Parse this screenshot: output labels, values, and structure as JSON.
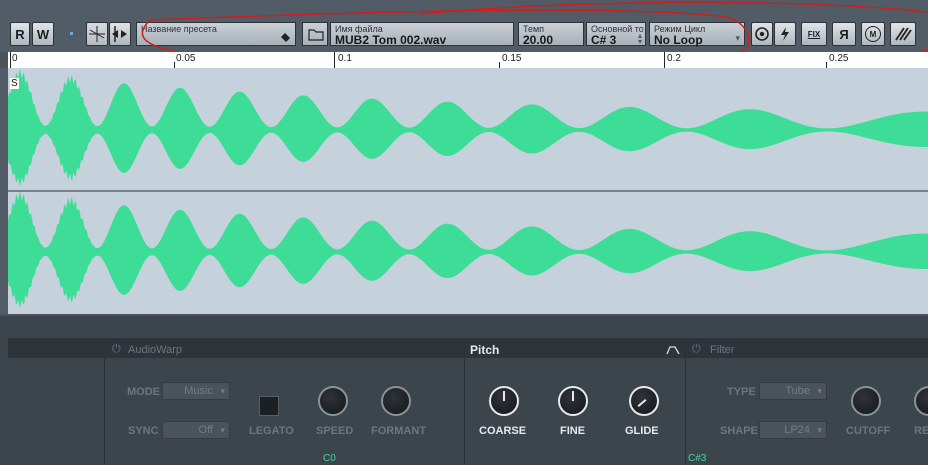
{
  "toolbar": {
    "r_label": "R",
    "w_label": "W",
    "preset": {
      "label": "Название пресета",
      "value": ""
    },
    "file": {
      "label": "Имя файла",
      "value": "MUB2 Tom 002.wav"
    },
    "tempo": {
      "label": "Темп",
      "value": "20.00"
    },
    "root": {
      "label": "Основной то",
      "value": "C# 3"
    },
    "loop": {
      "label": "Режим Цикл",
      "value": "No Loop"
    },
    "fix_label": "FIX",
    "ya_label": "Я",
    "m_label": "M"
  },
  "ruler": {
    "ticks": [
      "0",
      "0.05",
      "0.1",
      "0.15",
      "0.2",
      "0.25"
    ]
  },
  "wave": {
    "start_marker": "S",
    "color": "#3ddc97",
    "background": "#c5d1db"
  },
  "sections": {
    "audiowarp": {
      "title": "AudioWarp",
      "mode_label": "MODE",
      "mode_value": "Music",
      "sync_label": "SYNC",
      "sync_value": "Off",
      "legato_label": "LEGATO",
      "speed_label": "SPEED",
      "formant_label": "FORMANT"
    },
    "pitch": {
      "title": "Pitch",
      "coarse_label": "COARSE",
      "fine_label": "FINE",
      "glide_label": "GLIDE"
    },
    "filter": {
      "title": "Filter",
      "type_label": "TYPE",
      "type_value": "Tube",
      "shape_label": "SHAPE",
      "shape_value": "LP24",
      "cutoff_label": "CUTOFF",
      "res_label": "RE"
    }
  },
  "keys": {
    "left": "C0",
    "right": "C#3"
  },
  "annotation_color": "#cc1f1f"
}
